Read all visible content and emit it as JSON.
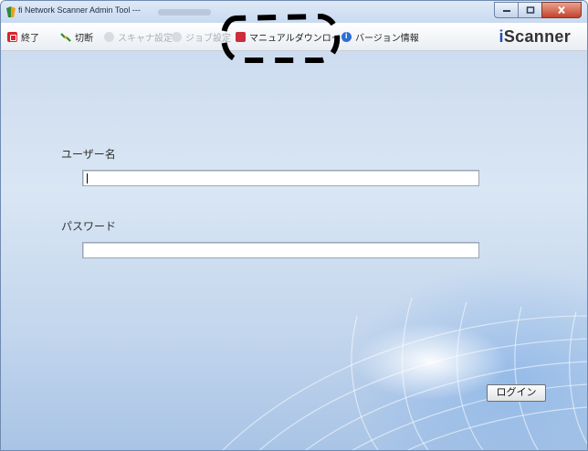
{
  "window": {
    "title": "fi Network Scanner Admin Tool ---",
    "controls": {
      "minimize": "─",
      "maximize": "□",
      "close": "x"
    }
  },
  "toolbar": {
    "items": [
      {
        "label": "終了",
        "icon": "exit-icon",
        "enabled": true
      },
      {
        "label": "切断",
        "icon": "disconnect-icon",
        "enabled": true
      },
      {
        "label": "スキャナ設定",
        "icon": "scanner-settings-icon",
        "enabled": false
      },
      {
        "label": "ジョブ設定",
        "icon": "job-settings-icon",
        "enabled": false
      },
      {
        "label": "マニュアルダウンロード",
        "icon": "manual-download-icon",
        "enabled": true
      },
      {
        "label": "バージョン情報",
        "icon": "info-icon",
        "enabled": true
      }
    ],
    "brand": {
      "prefix": "i",
      "name": "Scanner"
    }
  },
  "login": {
    "username_label": "ユーザー名",
    "username_value": "",
    "password_label": "パスワード",
    "password_value": "",
    "login_button": "ログイン"
  }
}
